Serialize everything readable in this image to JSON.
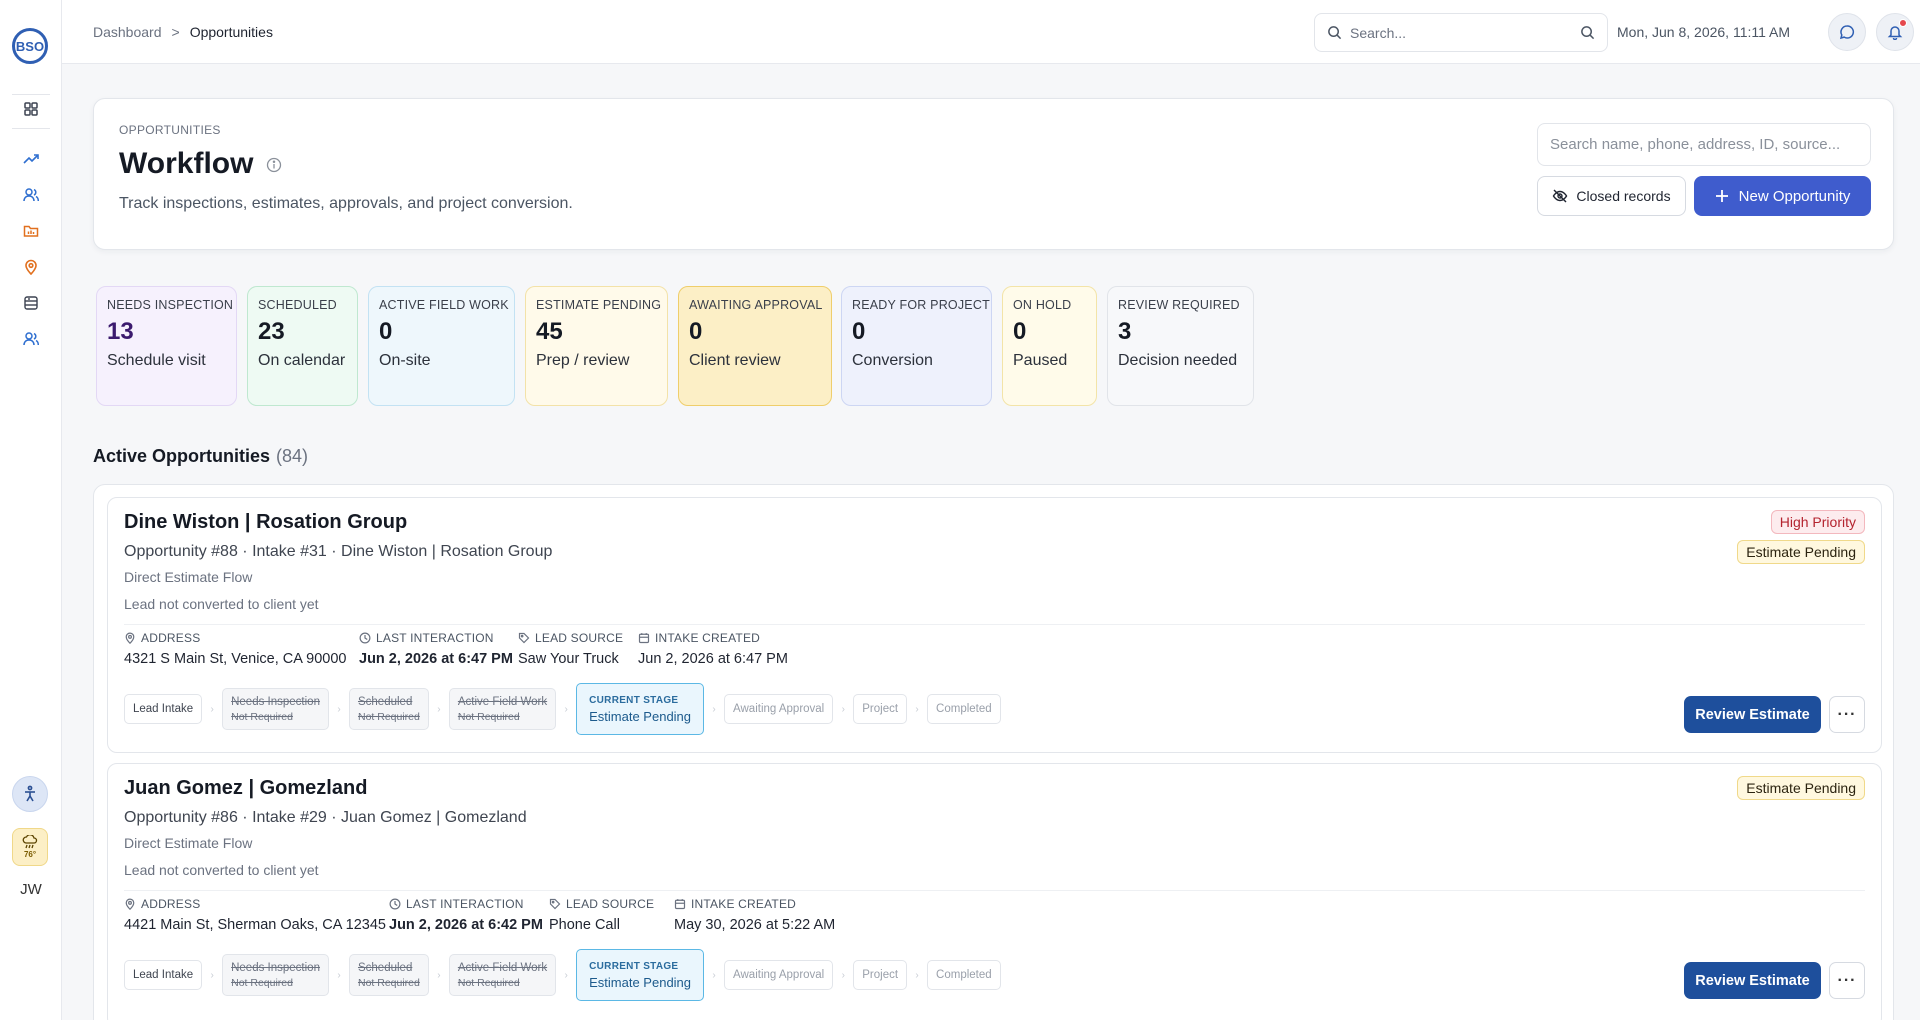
{
  "sidebar": {
    "logo_text": "BSO",
    "user_initials": "JW",
    "weather_temp": "76°",
    "icons": [
      "dashboard-grid-icon",
      "trending-up-icon",
      "users-icon",
      "folder-chart-icon",
      "map-pin-icon",
      "database-icon",
      "team-icon"
    ]
  },
  "topbar": {
    "breadcrumb_root": "Dashboard",
    "breadcrumb_sep": ">",
    "breadcrumb_current": "Opportunities",
    "search_placeholder": "Search...",
    "datetime": "Mon, Jun 8, 2026, 11:11 AM"
  },
  "header": {
    "eyebrow": "OPPORTUNITIES",
    "title": "Workflow",
    "subtitle": "Track inspections, estimates, approvals, and project conversion.",
    "search_placeholder": "Search name, phone, address, ID, source...",
    "closed_label": "Closed records",
    "new_label": "New Opportunity"
  },
  "stats": [
    {
      "label": "NEEDS INSPECTION",
      "value": "13",
      "desc": "Schedule visit",
      "bg": "#f6f1fd",
      "border": "#e3d8f5",
      "valueColor": "#3b1a6e"
    },
    {
      "label": "SCHEDULED",
      "value": "23",
      "desc": "On calendar",
      "bg": "#eefaf3",
      "border": "#bfe8d0",
      "valueColor": "#151a24"
    },
    {
      "label": "ACTIVE FIELD WORK",
      "value": "0",
      "desc": "On-site",
      "bg": "#eef7fc",
      "border": "#c3e2f3",
      "valueColor": "#151a24"
    },
    {
      "label": "ESTIMATE PENDING",
      "value": "45",
      "desc": "Prep / review",
      "bg": "#fffaea",
      "border": "#f3e2a8",
      "valueColor": "#151a24"
    },
    {
      "label": "AWAITING APPROVAL",
      "value": "0",
      "desc": "Client review",
      "bg": "#fcefc6",
      "border": "#efce6b",
      "valueColor": "#151a24"
    },
    {
      "label": "READY FOR PROJECT",
      "value": "0",
      "desc": "Conversion",
      "bg": "#eef1fc",
      "border": "#cdd6f3",
      "valueColor": "#151a24"
    },
    {
      "label": "ON HOLD",
      "value": "0",
      "desc": "Paused",
      "bg": "#fffbea",
      "border": "#f3e4a8",
      "valueColor": "#151a24"
    },
    {
      "label": "REVIEW REQUIRED",
      "value": "3",
      "desc": "Decision needed",
      "bg": "#f7f8fa",
      "border": "#e1e4e9",
      "valueColor": "#151a24"
    }
  ],
  "section": {
    "title": "Active Opportunities",
    "count": "(84)"
  },
  "meta_labels": {
    "address": "ADDRESS",
    "last_interaction": "LAST INTERACTION",
    "lead_source": "LEAD SOURCE",
    "intake_created": "INTAKE CREATED"
  },
  "pipeline_labels": {
    "lead_intake": "Lead Intake",
    "needs_inspection": "Needs Inspection",
    "scheduled": "Scheduled",
    "active_field_work": "Active Field Work",
    "not_required": "Not Required",
    "current_stage": "CURRENT STAGE",
    "estimate_pending": "Estimate Pending",
    "awaiting_approval": "Awaiting Approval",
    "project": "Project",
    "completed": "Completed"
  },
  "opportunities": [
    {
      "title": "Dine Wiston | Rosation Group",
      "subtitle": "Opportunity #88 · Intake #31 · Dine Wiston | Rosation Group",
      "flow": "Direct Estimate Flow",
      "conversion": "Lead not converted to client yet",
      "priority_badge": "High Priority",
      "stage_badge": "Estimate Pending",
      "address": "4321 S Main St, Venice, CA 90000",
      "last_interaction": "Jun 2, 2026 at 6:47 PM",
      "lead_source": "Saw Your Truck",
      "intake_created": "Jun 2, 2026 at 6:47 PM",
      "action_label": "Review Estimate",
      "more_label": "···"
    },
    {
      "title": "Juan Gomez | Gomezland",
      "subtitle": "Opportunity #86 · Intake #29 · Juan Gomez | Gomezland",
      "flow": "Direct Estimate Flow",
      "conversion": "Lead not converted to client yet",
      "stage_badge": "Estimate Pending",
      "address": "4421 Main St, Sherman Oaks, CA 12345",
      "last_interaction": "Jun 2, 2026 at 6:42 PM",
      "lead_source": "Phone Call",
      "intake_created": "May 30, 2026 at 5:22 AM",
      "action_label": "Review Estimate",
      "more_label": "···"
    }
  ]
}
